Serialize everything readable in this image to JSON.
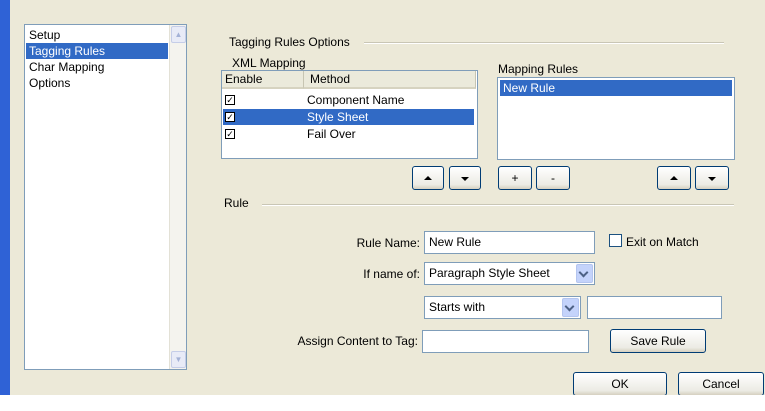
{
  "sidebar": {
    "items": [
      {
        "label": "Setup",
        "selected": false
      },
      {
        "label": "Tagging Rules",
        "selected": true
      },
      {
        "label": "Char Mapping",
        "selected": false
      },
      {
        "label": "Options",
        "selected": false
      }
    ]
  },
  "tagging_rules_options": {
    "title": "Tagging Rules Options",
    "xml_mapping": {
      "label": "XML Mapping",
      "columns": [
        "Enable",
        "Method"
      ],
      "rows": [
        {
          "enabled": true,
          "method": "Component Name",
          "selected": false
        },
        {
          "enabled": true,
          "method": "Style Sheet",
          "selected": true
        },
        {
          "enabled": true,
          "method": "Fail Over",
          "selected": false
        }
      ]
    },
    "mapping_rules": {
      "label": "Mapping Rules",
      "items": [
        {
          "label": "New Rule",
          "selected": true
        }
      ]
    },
    "buttons": {
      "up": "▲",
      "down": "▼",
      "add": "+",
      "remove": "-"
    }
  },
  "rule": {
    "title": "Rule",
    "rule_name_label": "Rule Name:",
    "rule_name_value": "New Rule",
    "exit_on_match_label": "Exit on Match",
    "exit_on_match_checked": false,
    "if_name_of_label": "If name of:",
    "if_name_of_value": "Paragraph Style Sheet",
    "condition_value": "Starts with",
    "condition_text": "",
    "assign_label": "Assign Content to Tag:",
    "assign_value": "",
    "save_rule_label": "Save Rule"
  },
  "footer": {
    "ok_label": "OK",
    "cancel_label": "Cancel"
  },
  "colors": {
    "selection": "#316ac5",
    "window_frame": "#2f62d6",
    "dialog_bg": "#ece9d8"
  }
}
